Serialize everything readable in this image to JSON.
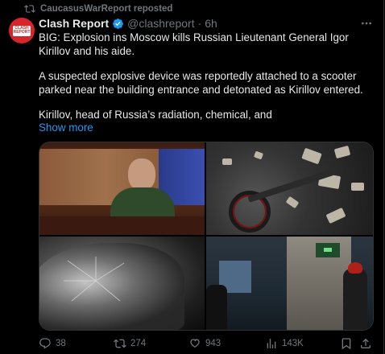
{
  "repost": {
    "text": "CaucasusWarReport reposted",
    "icon": "repost-icon"
  },
  "author": {
    "name": "Clash Report",
    "handle": "@clashreport",
    "separator": "·",
    "time": "6h",
    "avatar_lines": [
      "CLASH",
      "REPORT"
    ]
  },
  "tweet": {
    "paragraphs": [
      "BIG: Explosion ins Moscow kills Russian Lieutenant General Igor Kirillov and his aide.",
      "A suspected explosive device was reportedly attached to a scooter parked near the building entrance and detonated as Kirillov entered.",
      "Kirillov, head of Russia’s radiation, chemical, and"
    ],
    "show_more": "Show more"
  },
  "media": [
    {
      "id": "photo-general-speaking"
    },
    {
      "id": "photo-scooter-debris"
    },
    {
      "id": "photo-damaged-car"
    },
    {
      "id": "photo-building-entrance-firefighter"
    }
  ],
  "actions": {
    "replies": "38",
    "reposts": "274",
    "likes": "943",
    "views": "143K"
  },
  "colors": {
    "accent": "#1d9bf0",
    "avatar_bg": "#d7262b",
    "muted": "#71767b",
    "text": "#e7e9ea",
    "bg": "#000000"
  }
}
